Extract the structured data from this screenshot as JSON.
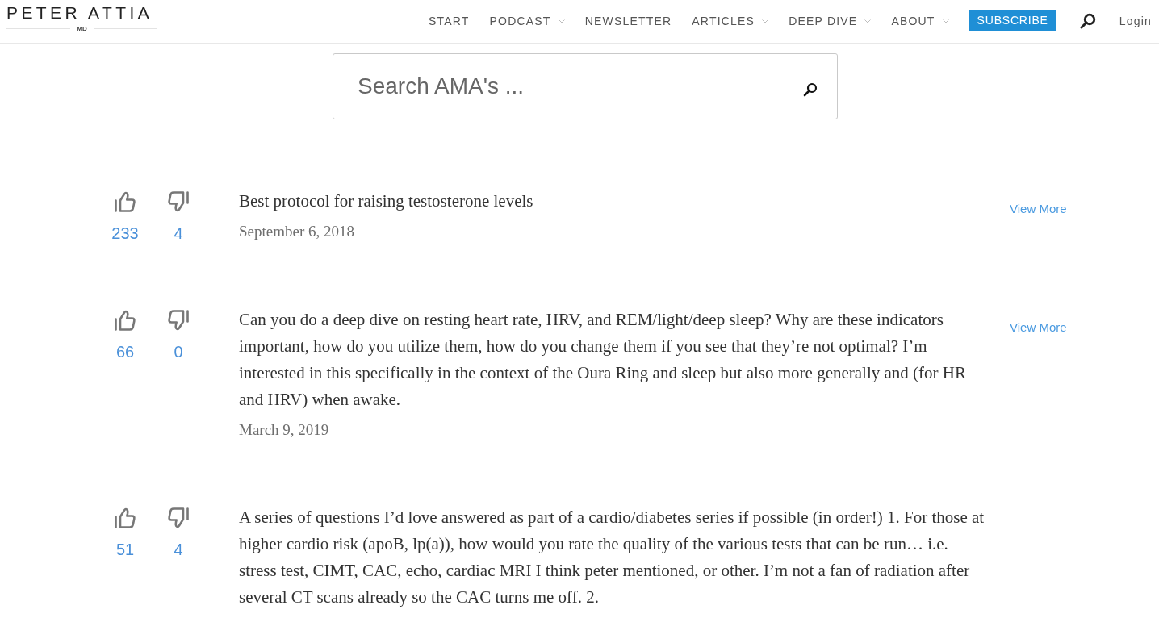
{
  "header": {
    "logo": {
      "name": "PETER ATTIA",
      "suffix": "MD"
    },
    "nav": [
      {
        "label": "START",
        "has_dropdown": false
      },
      {
        "label": "PODCAST",
        "has_dropdown": true
      },
      {
        "label": "NEWSLETTER",
        "has_dropdown": false
      },
      {
        "label": "ARTICLES",
        "has_dropdown": true
      },
      {
        "label": "DEEP DIVE",
        "has_dropdown": true
      },
      {
        "label": "ABOUT",
        "has_dropdown": true
      }
    ],
    "subscribe_button": "SUBSCRIBE",
    "login": "Login"
  },
  "search": {
    "placeholder": "Search AMA's ..."
  },
  "questions": [
    {
      "upvotes": "233",
      "downvotes": "4",
      "text": "Best protocol for raising testosterone levels",
      "date": "September 6, 2018",
      "link": "View More"
    },
    {
      "upvotes": "66",
      "downvotes": "0",
      "text": "Can you do a deep dive on resting heart rate, HRV, and REM/light/deep sleep? Why are these indicators important, how do you utilize them, how do you change them if you see that they’re not optimal? I’m interested in this specifically in the context of the Oura Ring and sleep but also more generally and (for HR and HRV) when awake.",
      "date": "March 9, 2019",
      "link": "View More"
    },
    {
      "upvotes": "51",
      "downvotes": "4",
      "text": "A series of questions I’d love answered as part of a cardio/diabetes series if possible (in order!) 1. For those at higher cardio risk (apoB, lp(a)), how would you rate the quality of the various tests that can be run… i.e. stress test, CIMT, CAC, echo, cardiac MRI I think peter mentioned, or other. I’m not a fan of radiation after several CT scans already so the CAC turns me off. 2."
    }
  ]
}
